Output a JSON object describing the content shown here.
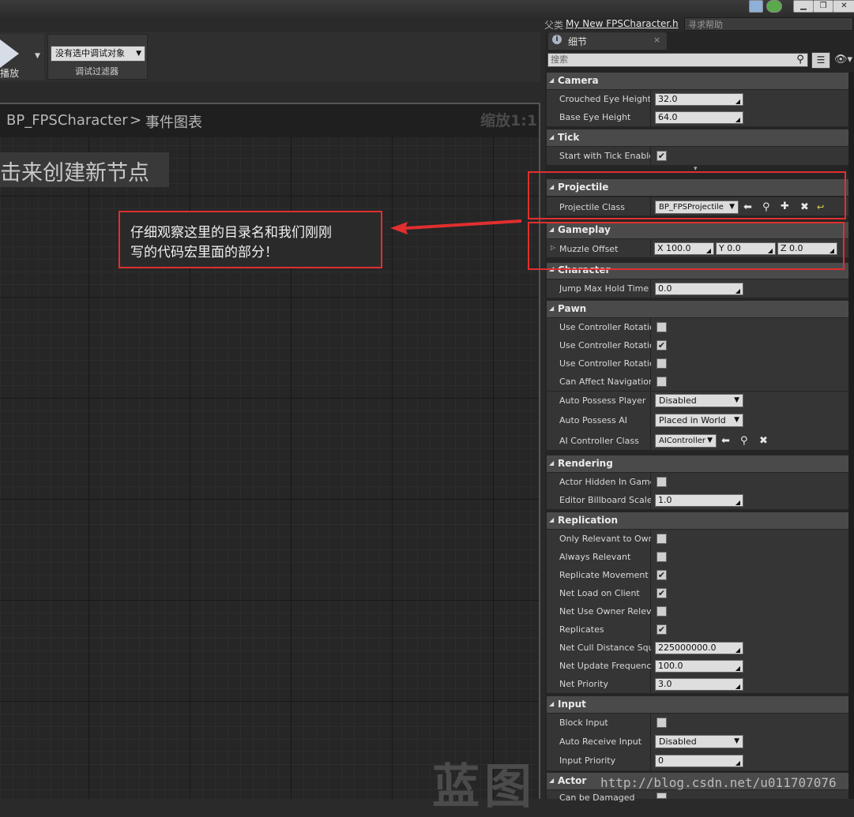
{
  "window": {
    "parent_label": "父类",
    "parent_value": "My New FPSCharacter.h",
    "help_placeholder": "寻求帮助"
  },
  "toolbar": {
    "play_label": "播放",
    "debug_select": "没有选中调试对象",
    "debug_caption": "调试过滤器"
  },
  "graph": {
    "breadcrumb_root": "BP_FPSCharacter",
    "breadcrumb_sep": ">",
    "breadcrumb_page": "事件图表",
    "zoom": "缩放1:1",
    "hint": "击来创建新节点",
    "watermark": "蓝图"
  },
  "annotation": {
    "line1": "仔细观察这里的目录名和我们刚刚",
    "line2": "写的代码宏里面的部分！"
  },
  "details": {
    "tab_label": "细节",
    "tab_close": "×",
    "search_placeholder": "搜索",
    "categories": {
      "camera": "Camera",
      "tick": "Tick",
      "projectile": "Projectile",
      "gameplay": "Gameplay",
      "character": "Character",
      "pawn": "Pawn",
      "rendering": "Rendering",
      "replication": "Replication",
      "input": "Input",
      "actor": "Actor"
    },
    "camera": {
      "crouched_label": "Crouched Eye Height",
      "crouched_value": "32.0",
      "base_label": "Base Eye Height",
      "base_value": "64.0"
    },
    "tick": {
      "start_label": "Start with Tick Enabled",
      "start_checked": true
    },
    "projectile": {
      "class_label": "Projectile Class",
      "class_value": "BP_FPSProjectile"
    },
    "gameplay": {
      "muzzle_label": "Muzzle Offset",
      "x": "X  100.0",
      "y": "Y  0.0",
      "z": "Z  0.0"
    },
    "character": {
      "jump_label": "Jump Max Hold Time",
      "jump_value": "0.0"
    },
    "pawn": {
      "ucr1": "Use Controller Rotation",
      "ucr2": "Use Controller Rotation",
      "ucr3": "Use Controller Rotation",
      "can_affect": "Can Affect Navigation",
      "auto_possess_player": "Auto Possess Player",
      "auto_possess_player_value": "Disabled",
      "auto_possess_ai": "Auto Possess AI",
      "auto_possess_ai_value": "Placed in World",
      "ai_class": "AI Controller Class",
      "ai_class_value": "AIController"
    },
    "rendering": {
      "hidden": "Actor Hidden In Game",
      "billboard": "Editor Billboard Scale",
      "billboard_value": "1.0"
    },
    "replication": {
      "only_relevant": "Only Relevant to Owner",
      "always_relevant": "Always Relevant",
      "replicate_movement": "Replicate Movement",
      "net_load": "Net Load on Client",
      "net_use_owner": "Net Use Owner Relevancy",
      "replicates": "Replicates",
      "net_cull": "Net Cull Distance Squared",
      "net_cull_value": "225000000.0",
      "net_update": "Net Update Frequency",
      "net_update_value": "100.0",
      "net_priority": "Net Priority",
      "net_priority_value": "3.0"
    },
    "input": {
      "block": "Block Input",
      "auto_receive": "Auto Receive Input",
      "auto_receive_value": "Disabled",
      "priority": "Input Priority",
      "priority_value": "0"
    },
    "actor": {
      "can_be_damaged": "Can be Damaged"
    }
  },
  "watermark_url": "http://blog.csdn.net/u011707076",
  "colors": {
    "annotation_red": "#e02f2f",
    "panel_bg": "#252525",
    "category_bg": "#4a4a4a"
  }
}
